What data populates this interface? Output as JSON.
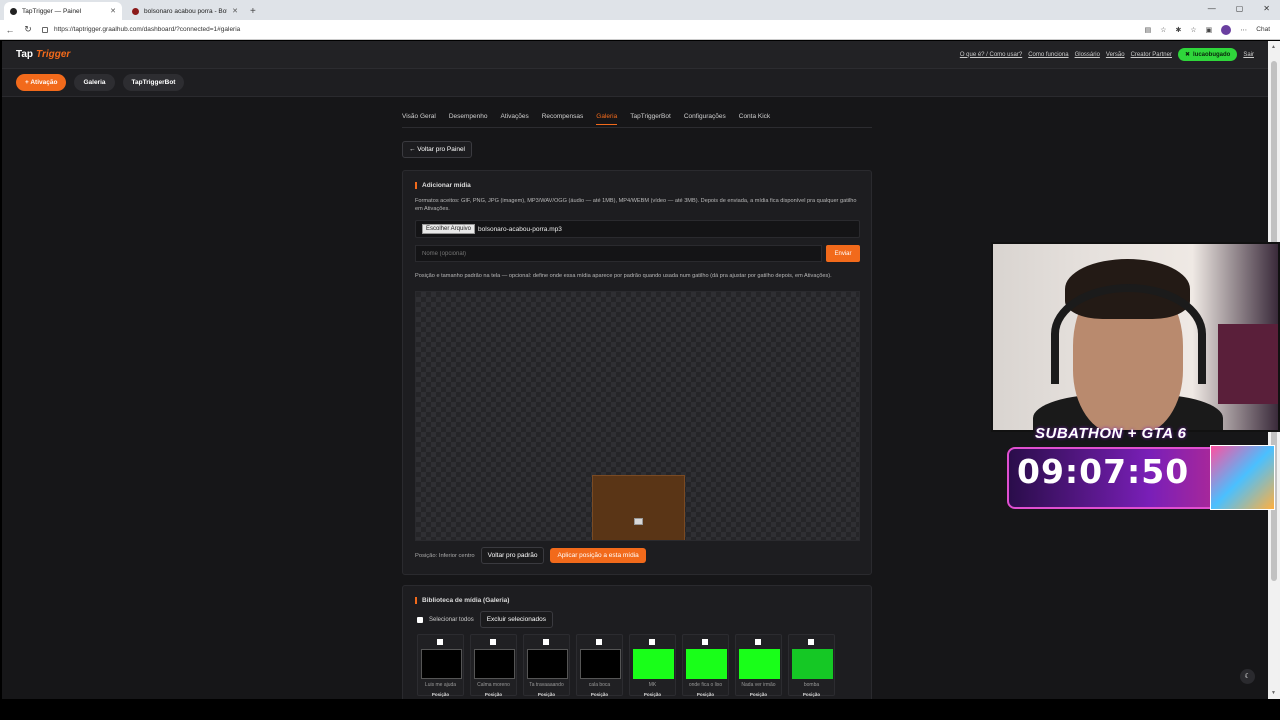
{
  "browser": {
    "tabs": [
      {
        "title": "TapTrigger — Painel",
        "fav": "#222222",
        "active": true
      },
      {
        "title": "bolsonaro acabou porra - Botão d",
        "fav": "#8b1a1a",
        "active": false
      }
    ],
    "url": "https://taptrigger.graalhub.com/dashboard/?connected=1#galeria",
    "chat_label": "Chat"
  },
  "site": {
    "logo_a": "Tap",
    "logo_b": "Trigger",
    "top_links": [
      "O que é? / Como usar?",
      "Como funciona",
      "Glossário",
      "Versão",
      "Creator Partner"
    ],
    "user": "lucaobugado",
    "logout": "Sair",
    "subbar": {
      "activation": "+ Ativação",
      "gallery": "Galeria",
      "bot": "TapTriggerBot"
    },
    "nav_tabs": [
      "Visão Geral",
      "Desempenho",
      "Ativações",
      "Recompensas",
      "Galeria",
      "TapTriggerBot",
      "Configurações",
      "Conta Kick"
    ],
    "active_tab": "Galeria",
    "back": "← Voltar pro Painel"
  },
  "add_media": {
    "title": "Adicionar mídia",
    "desc": "Formatos aceitos: GIF, PNG, JPG (imagem), MP3/WAV/OGG (áudio — até 1MB), MP4/WEBM (vídeo — até 3MB). Depois de enviada, a mídia fica disponível pra qualquer gatilho em Ativações.",
    "file_button": "Escolher Arquivo",
    "file_name": "bolsonaro-acabou-porra.mp3",
    "name_placeholder": "Nome (opcional)",
    "send": "Enviar",
    "pos_desc": "Posição e tamanho padrão na tela — opcional: define onde essa mídia aparece por padrão quando usada num gatilho (dá pra ajustar por gatilho depois, em Ativações).",
    "pos_label": "Posição: Inferior centro",
    "reset": "Voltar pro padrão",
    "apply": "Aplicar posição a esta mídia"
  },
  "library": {
    "title": "Biblioteca de mídia (Galeria)",
    "select_all": "Selecionar todos",
    "delete_selected": "Excluir selecionados",
    "pos_tag": "Posição",
    "items": [
      {
        "name": "Luis me ajuda",
        "color": "#000000"
      },
      {
        "name": "Calma moreno",
        "color": "#000000"
      },
      {
        "name": "Ta travaaaando",
        "color": "#000000"
      },
      {
        "name": "cala boca",
        "color": "#000000"
      },
      {
        "name": "MK",
        "color": "#19ff19"
      },
      {
        "name": "onde fica o lixo",
        "color": "#19ff19"
      },
      {
        "name": "Nada ver irmão",
        "color": "#19ff19"
      },
      {
        "name": "bomba",
        "color": "#15c825"
      }
    ]
  },
  "overlay": {
    "title": "SUBATHON + GTA 6",
    "timer": "09:07:50"
  },
  "theme_icon": "moon-icon"
}
